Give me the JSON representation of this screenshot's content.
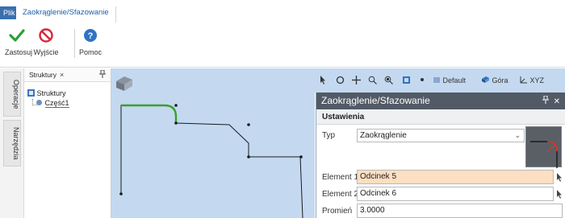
{
  "menu": {
    "file_tab": "Plik",
    "active_tab": "Zaokrąglenie/Sfazowanie"
  },
  "ribbon": {
    "apply_label": "Zastosuj",
    "exit_label": "Wyjście",
    "help_label": "Pomoc"
  },
  "left_strip": {
    "tab_operations": "Operacje",
    "tab_tools": "Narzędzia"
  },
  "structure_panel": {
    "tab_label": "Struktury",
    "close_glyph": "×",
    "pin_glyph": "⊓",
    "tree_root": "Struktury",
    "tree_child": "Część1"
  },
  "view_toolbar": {
    "default_label": "Default",
    "top_label": "Góra",
    "xyz_label": "XYZ"
  },
  "dialog": {
    "title": "Zaokrąglenie/Sfazowanie",
    "section_label": "Ustawienia",
    "type_label": "Typ",
    "type_value": "Zaokrąglenie",
    "element1_label": "Element 1",
    "element1_value": "Odcinek 5",
    "element2_label": "Element 2",
    "element2_value": "Odcinek 6",
    "radius_label": "Promień",
    "radius_value": "3.0000"
  },
  "colors": {
    "accent": "#1f5fa8",
    "viewport_bg": "#c4d9f0",
    "highlight_field": "#fddfc2",
    "fillet_curve": "#3aa02d",
    "dialog_title_bg": "#525a66"
  }
}
